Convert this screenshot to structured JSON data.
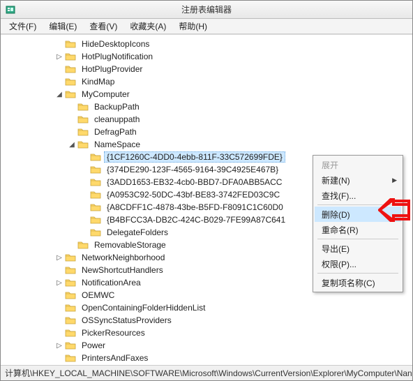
{
  "window": {
    "title": "注册表编辑器"
  },
  "menubar": {
    "file": "文件(F)",
    "edit": "编辑(E)",
    "view": "查看(V)",
    "favorites": "收藏夹(A)",
    "help": "帮助(H)"
  },
  "tree": {
    "items": [
      {
        "indent": 4,
        "toggle": "",
        "label": "HideDesktopIcons"
      },
      {
        "indent": 4,
        "toggle": "▷",
        "label": "HotPlugNotification"
      },
      {
        "indent": 4,
        "toggle": "",
        "label": "HotPlugProvider"
      },
      {
        "indent": 4,
        "toggle": "",
        "label": "KindMap"
      },
      {
        "indent": 4,
        "toggle": "◢",
        "label": "MyComputer"
      },
      {
        "indent": 5,
        "toggle": "",
        "label": "BackupPath"
      },
      {
        "indent": 5,
        "toggle": "",
        "label": "cleanuppath"
      },
      {
        "indent": 5,
        "toggle": "",
        "label": "DefragPath"
      },
      {
        "indent": 5,
        "toggle": "◢",
        "label": "NameSpace"
      },
      {
        "indent": 6,
        "toggle": "",
        "label": "{1CF1260C-4DD0-4ebb-811F-33C572699FDE}",
        "selected": true
      },
      {
        "indent": 6,
        "toggle": "",
        "label": "{374DE290-123F-4565-9164-39C4925E467B}"
      },
      {
        "indent": 6,
        "toggle": "",
        "label": "{3ADD1653-EB32-4cb0-BBD7-DFA0ABB5ACC"
      },
      {
        "indent": 6,
        "toggle": "",
        "label": "{A0953C92-50DC-43bf-BE83-3742FED03C9C"
      },
      {
        "indent": 6,
        "toggle": "",
        "label": "{A8CDFF1C-4878-43be-B5FD-F8091C1C60D0"
      },
      {
        "indent": 6,
        "toggle": "",
        "label": "{B4BFCC3A-DB2C-424C-B029-7FE99A87C641"
      },
      {
        "indent": 6,
        "toggle": "",
        "label": "DelegateFolders"
      },
      {
        "indent": 5,
        "toggle": "",
        "label": "RemovableStorage"
      },
      {
        "indent": 4,
        "toggle": "▷",
        "label": "NetworkNeighborhood"
      },
      {
        "indent": 4,
        "toggle": "",
        "label": "NewShortcutHandlers"
      },
      {
        "indent": 4,
        "toggle": "▷",
        "label": "NotificationArea"
      },
      {
        "indent": 4,
        "toggle": "",
        "label": "OEMWC"
      },
      {
        "indent": 4,
        "toggle": "",
        "label": "OpenContainingFolderHiddenList"
      },
      {
        "indent": 4,
        "toggle": "",
        "label": "OSSyncStatusProviders"
      },
      {
        "indent": 4,
        "toggle": "",
        "label": "PickerResources"
      },
      {
        "indent": 4,
        "toggle": "▷",
        "label": "Power"
      },
      {
        "indent": 4,
        "toggle": "",
        "label": "PrintersAndFaxes"
      }
    ]
  },
  "context_menu": {
    "expand": "展开",
    "new": "新建(N)",
    "find": "查找(F)...",
    "delete": "删除(D)",
    "rename": "重命名(R)",
    "export": "导出(E)",
    "permissions": "权限(P)...",
    "copy_key_name": "复制项名称(C)"
  },
  "statusbar": {
    "path": "计算机\\HKEY_LOCAL_MACHINE\\SOFTWARE\\Microsoft\\Windows\\CurrentVersion\\Explorer\\MyComputer\\Nan"
  }
}
